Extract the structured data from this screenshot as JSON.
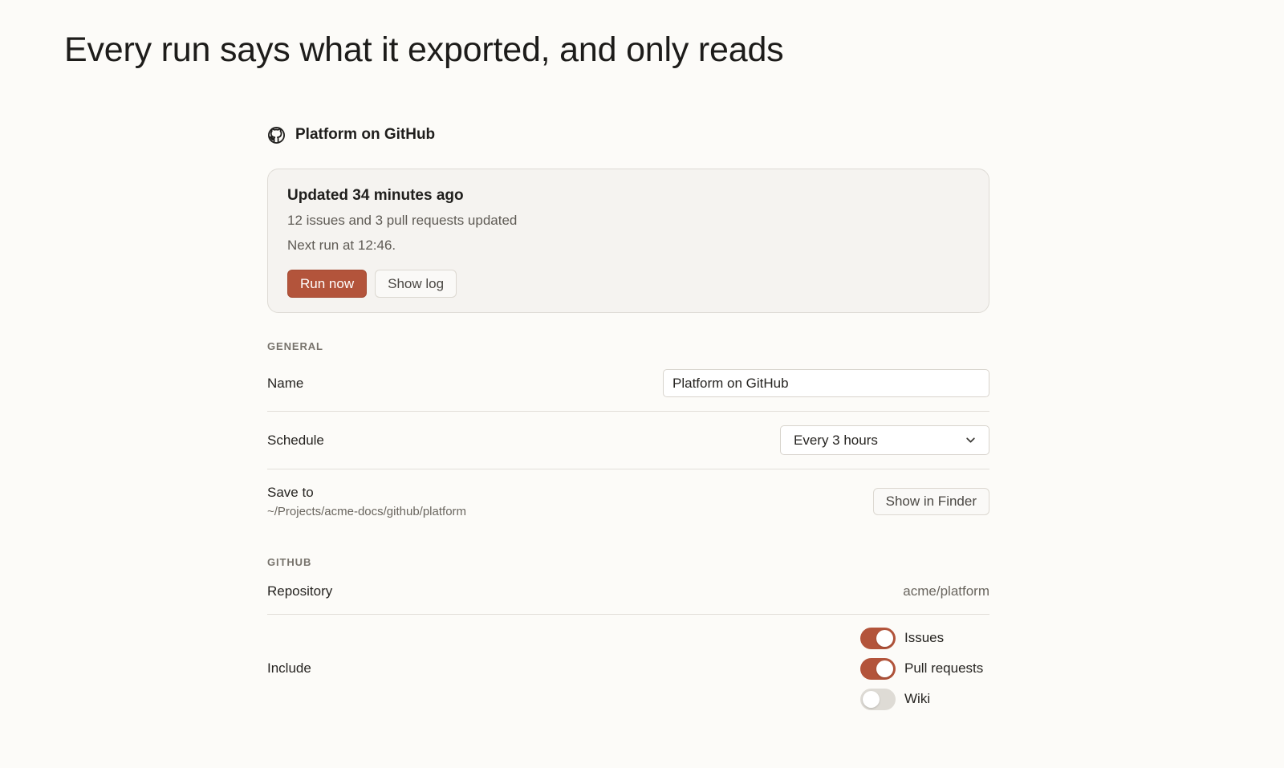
{
  "headline": "Every run says what it exported, and only reads",
  "source": {
    "icon": "github-icon",
    "title": "Platform on GitHub"
  },
  "status": {
    "title": "Updated 34 minutes ago",
    "summary": "12 issues and 3 pull requests updated",
    "next_run": "Next run at 12:46.",
    "run_now_label": "Run now",
    "show_log_label": "Show log"
  },
  "general": {
    "section_label": "GENERAL",
    "name_label": "Name",
    "name_value": "Platform on GitHub",
    "schedule_label": "Schedule",
    "schedule_value": "Every 3 hours",
    "save_to_label": "Save to",
    "save_to_path": "~/Projects/acme-docs/github/platform",
    "show_in_finder_label": "Show in Finder"
  },
  "github": {
    "section_label": "GITHUB",
    "repository_label": "Repository",
    "repository_value": "acme/platform",
    "include_label": "Include",
    "include_options": [
      {
        "label": "Issues",
        "enabled": true
      },
      {
        "label": "Pull requests",
        "enabled": true
      },
      {
        "label": "Wiki",
        "enabled": false
      }
    ]
  },
  "colors": {
    "accent": "#b3543b",
    "background": "#fcfbf8",
    "card": "#f5f3f0"
  }
}
